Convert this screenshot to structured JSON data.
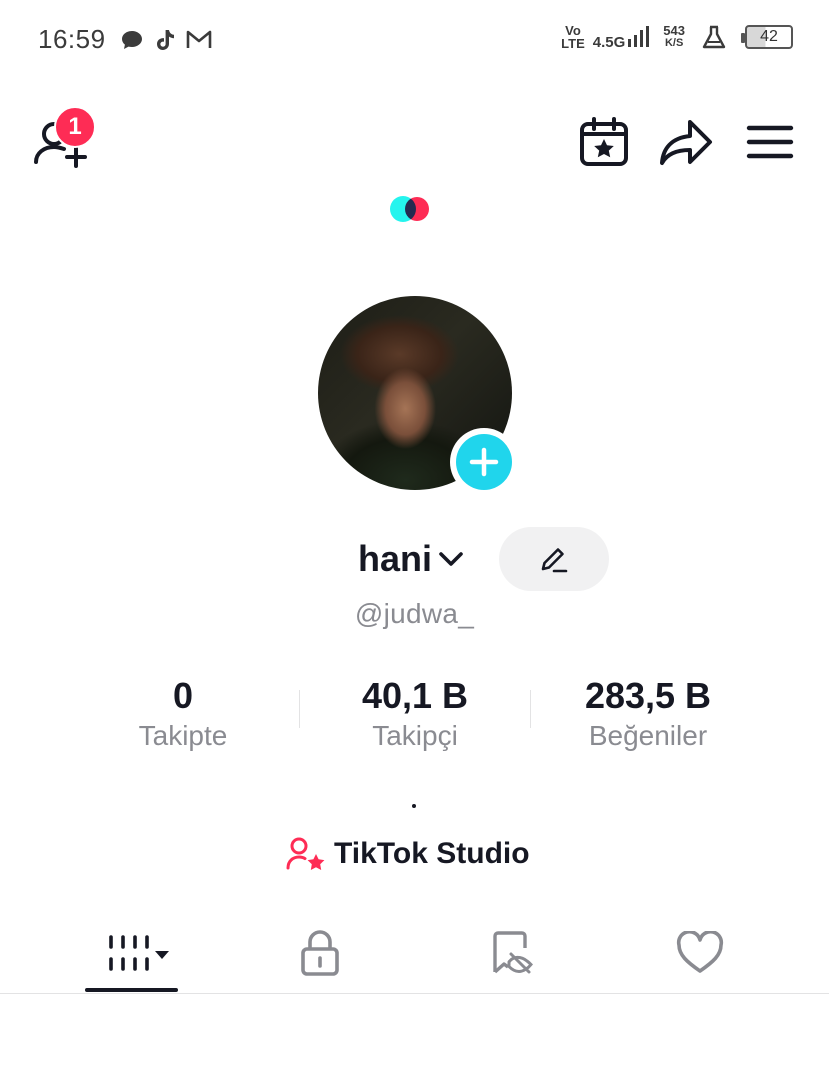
{
  "status_bar": {
    "time": "16:59",
    "network_top": "Vo",
    "network_bottom": "LTE",
    "gen": "4.5G",
    "speed_value": "543",
    "speed_unit": "K/S",
    "battery": "42"
  },
  "header": {
    "notification_count": "1"
  },
  "profile": {
    "display_name": "hani",
    "username": "@judwa_"
  },
  "stats": [
    {
      "value": "0",
      "label": "Takipte"
    },
    {
      "value": "40,1 B",
      "label": "Takipçi"
    },
    {
      "value": "283,5 B",
      "label": "Beğeniler"
    }
  ],
  "studio": {
    "label": "TikTok Studio"
  },
  "colors": {
    "accent_red": "#fe2c55",
    "accent_cyan": "#25f4ee",
    "plus_button": "#20d5ec"
  },
  "icons": {
    "add_friend": "add-friend-icon",
    "calendar": "calendar-star-icon",
    "share": "share-icon",
    "menu": "menu-icon",
    "edit": "pencil-icon",
    "tab_videos": "grid-icon",
    "tab_private": "lock-icon",
    "tab_reposts": "eye-off-icon",
    "tab_liked": "heart-icon"
  }
}
